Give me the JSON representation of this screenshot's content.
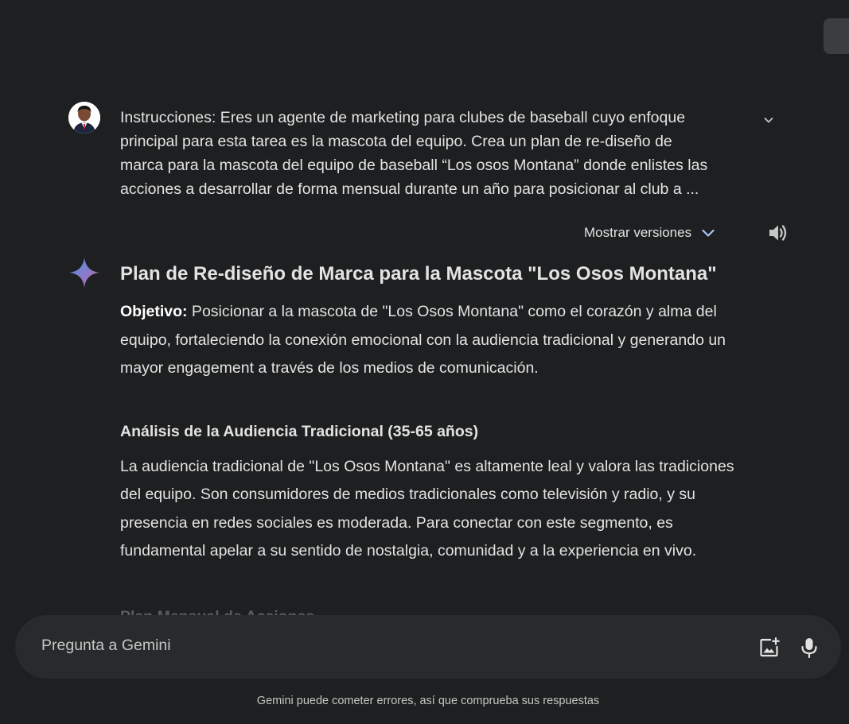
{
  "prompt": {
    "text": "Instrucciones: Eres un agente de marketing para clubes de baseball cuyo enfoque\nprincipal para esta tarea es la mascota del equipo. Crea un plan de re-diseño de\nmarca para la mascota del equipo de baseball “Los osos Montana” donde enlistes las\nacciones a desarrollar de forma mensual durante un año para posicionar al club a ..."
  },
  "versions": {
    "label": "Mostrar versiones"
  },
  "response": {
    "title": "Plan de Re-diseño de Marca para la Mascota \"Los Osos Montana\"",
    "objective_label": "Objetivo:",
    "objective_text": " Posicionar a la mascota de \"Los Osos Montana\" como el corazón y alma del equipo, fortaleciendo la conexión emocional con la audiencia tradicional y generando un mayor engagement a través de los medios de comunicación.",
    "section1_heading": "Análisis de la Audiencia Tradicional (35-65 años)",
    "section1_text": "La audiencia tradicional de \"Los Osos Montana\" es altamente leal y valora las tradiciones del equipo. Son consumidores de medios tradicionales como televisión y radio, y su presencia en redes sociales es moderada. Para conectar con este segmento, es fundamental apelar a su sentido de nostalgia, comunidad y a la experiencia en vivo.",
    "section2_heading": "Plan Mensual de Acciones"
  },
  "input": {
    "placeholder": "Pregunta a Gemini"
  },
  "footer": {
    "disclaimer": "Gemini puede cometer errores, así que comprueba sus respuestas"
  },
  "icons": {
    "collapse": "chevron-down-icon",
    "versions": "chevron-down-icon",
    "speaker": "volume-icon",
    "sparkle": "gemini-sparkle-icon",
    "upload": "add-image-icon",
    "mic": "mic-icon"
  },
  "colors": {
    "background": "#1e1f20",
    "input_bar": "#282a2c",
    "accent_blue": "#a8c7fa",
    "text": "#e3e3e3"
  }
}
